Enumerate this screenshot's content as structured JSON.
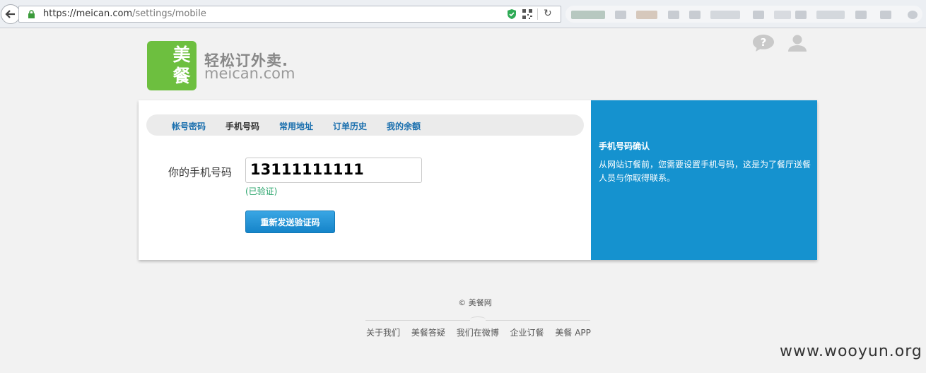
{
  "browser": {
    "url_host": "https://meican.com",
    "url_path": "/settings/mobile"
  },
  "logo": {
    "char_top": "美",
    "char_bottom": "餐",
    "slogan": "轻松订外卖.",
    "domain": "meican.com"
  },
  "tabs": [
    {
      "label": "帐号密码",
      "active": false
    },
    {
      "label": "手机号码",
      "active": true
    },
    {
      "label": "常用地址",
      "active": false
    },
    {
      "label": "订单历史",
      "active": false
    },
    {
      "label": "我的余额",
      "active": false
    }
  ],
  "form": {
    "phone_label": "你的手机号码",
    "phone_value": "13111111111",
    "verified_text": "(已验证)",
    "resend_button": "重新发送验证码"
  },
  "side_panel": {
    "title": "手机号码确认",
    "description": "从网站订餐前，您需要设置手机号码，这是为了餐厅送餐人员与你取得联系。"
  },
  "footer": {
    "copyright": "© 美餐网",
    "links": [
      "关于我们",
      "美餐答疑",
      "我们在微博",
      "企业订餐",
      "美餐 APP"
    ]
  },
  "watermark": "www.wooyun.org",
  "colors": {
    "brand_green": "#6dbf3f",
    "accent_blue": "#1592cf",
    "verified_green": "#27a36a"
  }
}
